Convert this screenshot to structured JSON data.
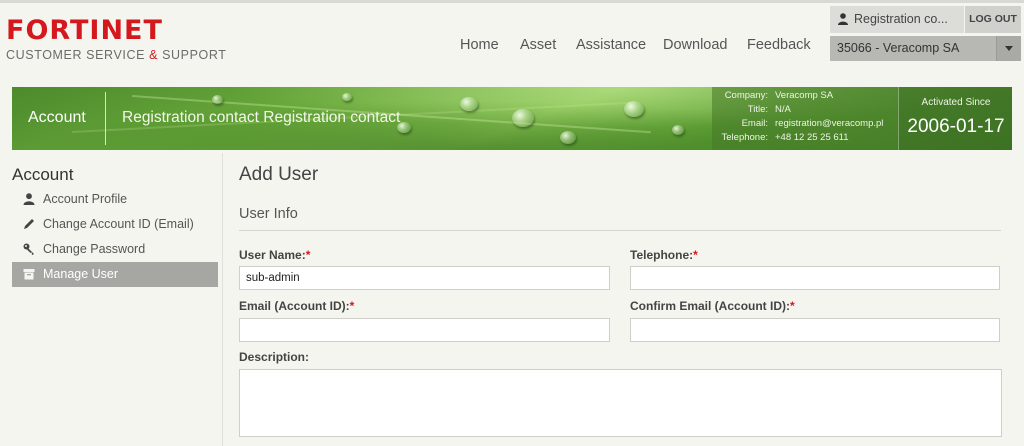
{
  "header": {
    "logo_wordmark": "FORTINET",
    "logo_tagline_prefix": "CUSTOMER SERVICE ",
    "logo_tagline_amp": "&",
    "logo_tagline_suffix": " SUPPORT",
    "nav": [
      "Home",
      "Asset",
      "Assistance",
      "Download",
      "Feedback"
    ],
    "user_label": "Registration co...",
    "logout_label": "LOG OUT",
    "account_selected": "35066 - Veracomp SA"
  },
  "banner": {
    "section": "Account",
    "contact_title": "Registration contact Registration contact",
    "info": [
      {
        "key": "Company:",
        "value": "Veracomp SA"
      },
      {
        "key": "Title:",
        "value": "N/A"
      },
      {
        "key": "Email:",
        "value": "registration@veracomp.pl"
      },
      {
        "key": "Telephone:",
        "value": "+48 12 25 25 611"
      }
    ],
    "activated_label": "Activated Since",
    "activated_date": "2006-01-17"
  },
  "sidebar": {
    "title": "Account",
    "items": [
      {
        "label": "Account Profile",
        "icon": "person-icon"
      },
      {
        "label": "Change Account ID (Email)",
        "icon": "pencil-icon"
      },
      {
        "label": "Change Password",
        "icon": "key-icon"
      },
      {
        "label": "Manage User",
        "icon": "archive-icon",
        "active": true
      }
    ]
  },
  "form": {
    "page_title": "Add User",
    "section_title": "User Info",
    "required_mark": "*",
    "fields": {
      "user_name": {
        "label": "User Name:",
        "value": "sub-admin"
      },
      "telephone": {
        "label": "Telephone:",
        "value": ""
      },
      "email": {
        "label": "Email (Account ID):",
        "value": ""
      },
      "confirm_email": {
        "label": "Confirm Email (Account ID):",
        "value": ""
      },
      "description": {
        "label": "Description:",
        "value": ""
      }
    }
  },
  "colors": {
    "brand_red": "#d3181e",
    "active_item_bg": "#a6a6a2",
    "banner_green": "#6aa93b"
  }
}
